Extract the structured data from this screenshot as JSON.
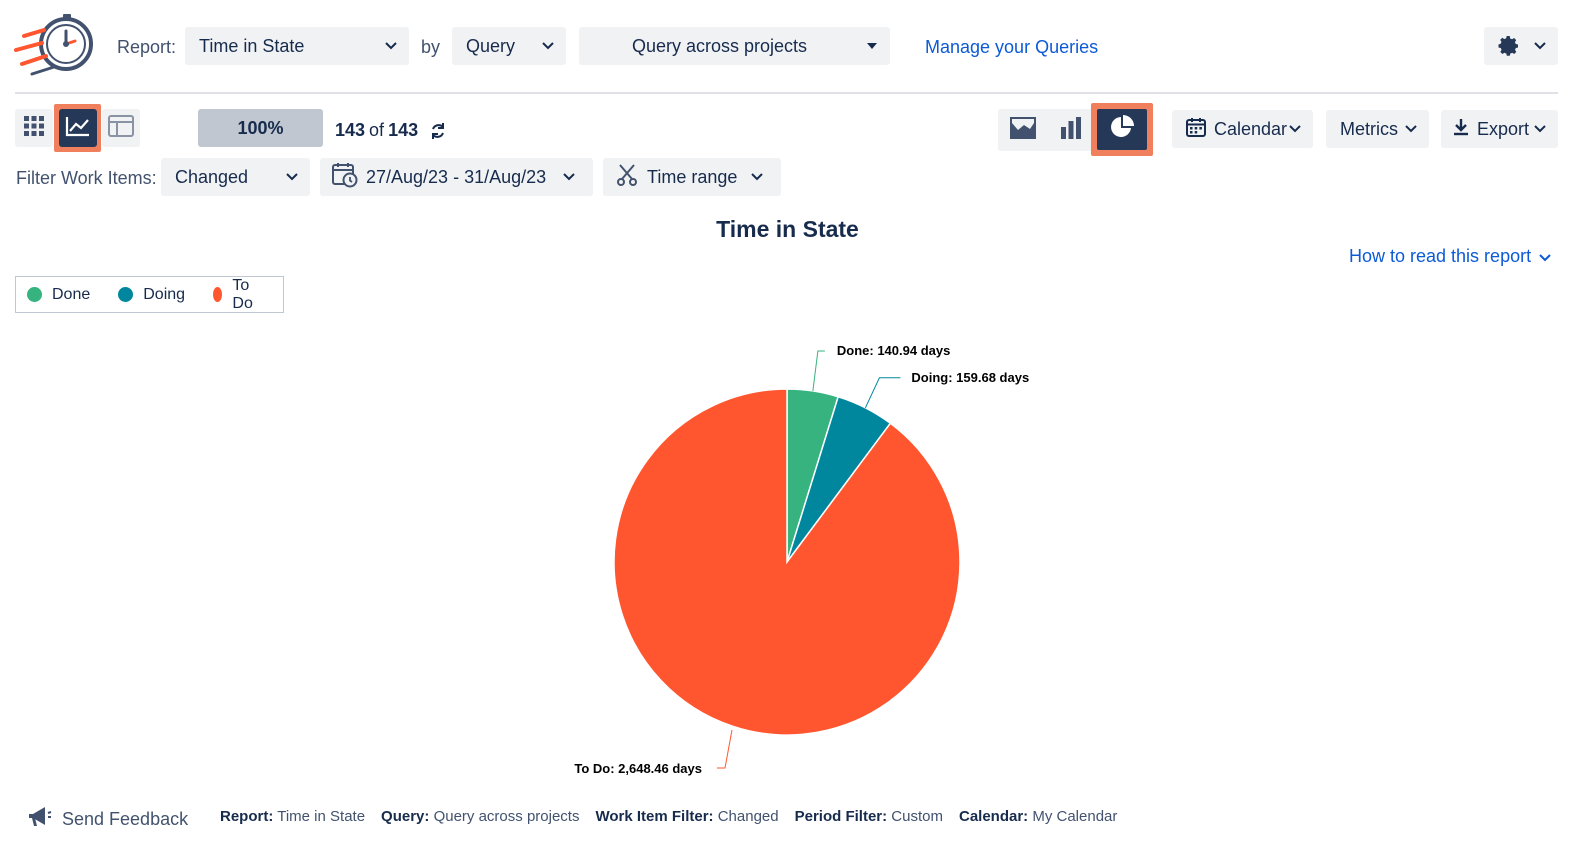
{
  "header": {
    "report_label": "Report:",
    "report_value": "Time in State",
    "by_label": "by",
    "by_value": "Query",
    "query_value": "Query across projects",
    "manage_link": "Manage your Queries"
  },
  "toolbar": {
    "progress": "100%",
    "count_current": "143",
    "count_of": "of",
    "count_total": "143",
    "calendar_label": "Calendar",
    "metrics_label": "Metrics",
    "export_label": "Export"
  },
  "filters": {
    "label": "Filter Work Items:",
    "changed": "Changed",
    "date_range": "27/Aug/23 - 31/Aug/23",
    "time_range": "Time range"
  },
  "chart_data": {
    "type": "pie",
    "title": "Time in State",
    "legend_position": "top-left",
    "series": [
      {
        "name": "Done",
        "value": 140.94,
        "label": "Done: 140.94 days",
        "color": "#36b37e"
      },
      {
        "name": "Doing",
        "value": 159.68,
        "label": "Doing: 159.68 days",
        "color": "#00879e"
      },
      {
        "name": "To Do",
        "value": 2648.46,
        "label": "To Do: 2,648.46 days",
        "color": "#ff5630"
      }
    ]
  },
  "help": {
    "how_to_read": "How to read this report"
  },
  "footer": {
    "send_feedback": "Send Feedback",
    "report_key": "Report:",
    "report_val": "Time in State",
    "query_key": "Query:",
    "query_val": "Query across projects",
    "wif_key": "Work Item Filter:",
    "wif_val": "Changed",
    "period_key": "Period Filter:",
    "period_val": "Custom",
    "calendar_key": "Calendar:",
    "calendar_val": "My Calendar"
  },
  "colors": {
    "accent_link": "#0c5ad6",
    "highlight": "#f0805d",
    "dark_button": "#253858"
  }
}
